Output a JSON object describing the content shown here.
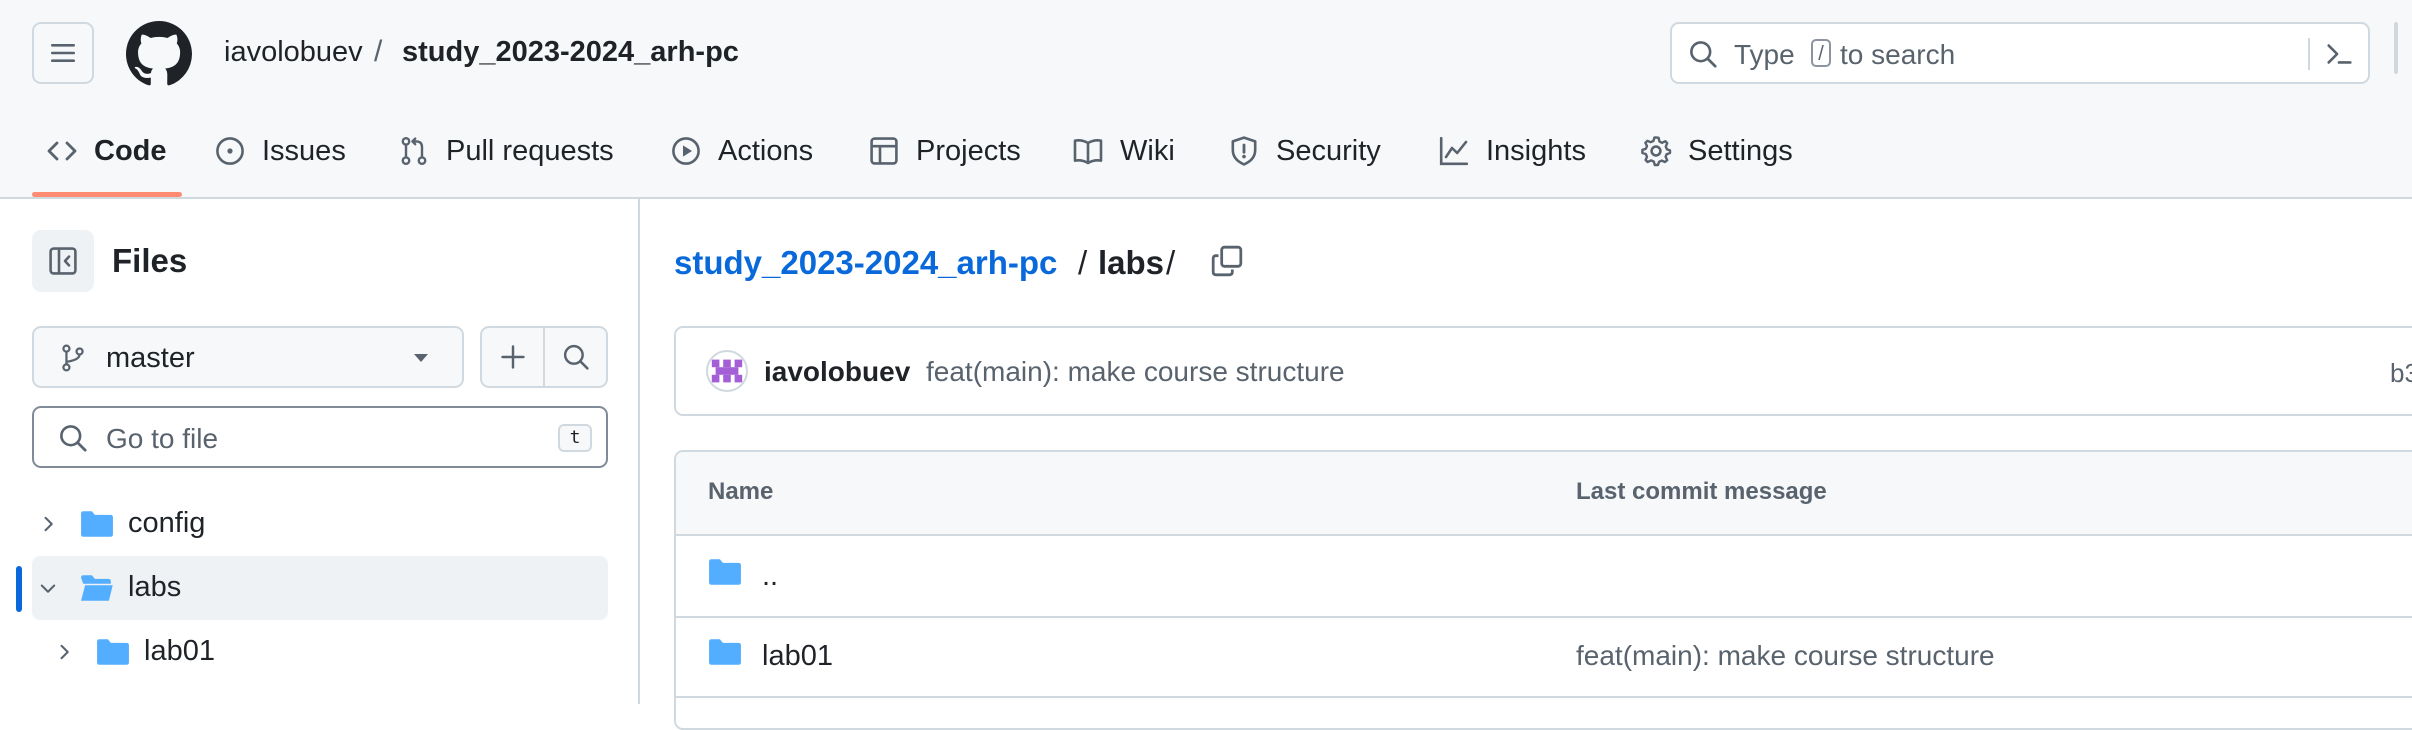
{
  "header": {
    "owner": "iavolobuev",
    "separator": "/",
    "repo": "study_2023-2024_arh-pc",
    "search": {
      "prefix": "Type",
      "key": "/",
      "suffix": "to search"
    }
  },
  "tabs": [
    {
      "label": "Code",
      "icon": "code-icon",
      "active": true
    },
    {
      "label": "Issues",
      "icon": "issue-icon"
    },
    {
      "label": "Pull requests",
      "icon": "pull-request-icon"
    },
    {
      "label": "Actions",
      "icon": "play-icon"
    },
    {
      "label": "Projects",
      "icon": "table-icon"
    },
    {
      "label": "Wiki",
      "icon": "book-icon"
    },
    {
      "label": "Security",
      "icon": "shield-icon"
    },
    {
      "label": "Insights",
      "icon": "graph-icon"
    },
    {
      "label": "Settings",
      "icon": "gear-icon"
    }
  ],
  "sidebar": {
    "title": "Files",
    "branch": "master",
    "goto_placeholder": "Go to file",
    "goto_shortcut": "t",
    "tree": [
      {
        "label": "config",
        "expanded": false
      },
      {
        "label": "labs",
        "expanded": true,
        "selected": true
      },
      {
        "label": "lab01",
        "expanded": false
      }
    ]
  },
  "main": {
    "breadcrumb": {
      "repo": "study_2023-2024_arh-pc",
      "sep1": "/",
      "folder": "labs",
      "sep2": "/"
    },
    "commit": {
      "author": "iavolobuev",
      "message": "feat(main): make course structure",
      "sha_fragment": "b3"
    },
    "table": {
      "headers": {
        "name": "Name",
        "message": "Last commit message"
      },
      "rows": [
        {
          "name": "..",
          "message": ""
        },
        {
          "name": "lab01",
          "message": "feat(main): make course structure"
        }
      ]
    }
  },
  "colors": {
    "accent_link": "#0969da",
    "folder": "#54aeff",
    "tab_underline": "#fd8c73",
    "border": "#d1d9e0",
    "muted_text": "#59636e"
  }
}
